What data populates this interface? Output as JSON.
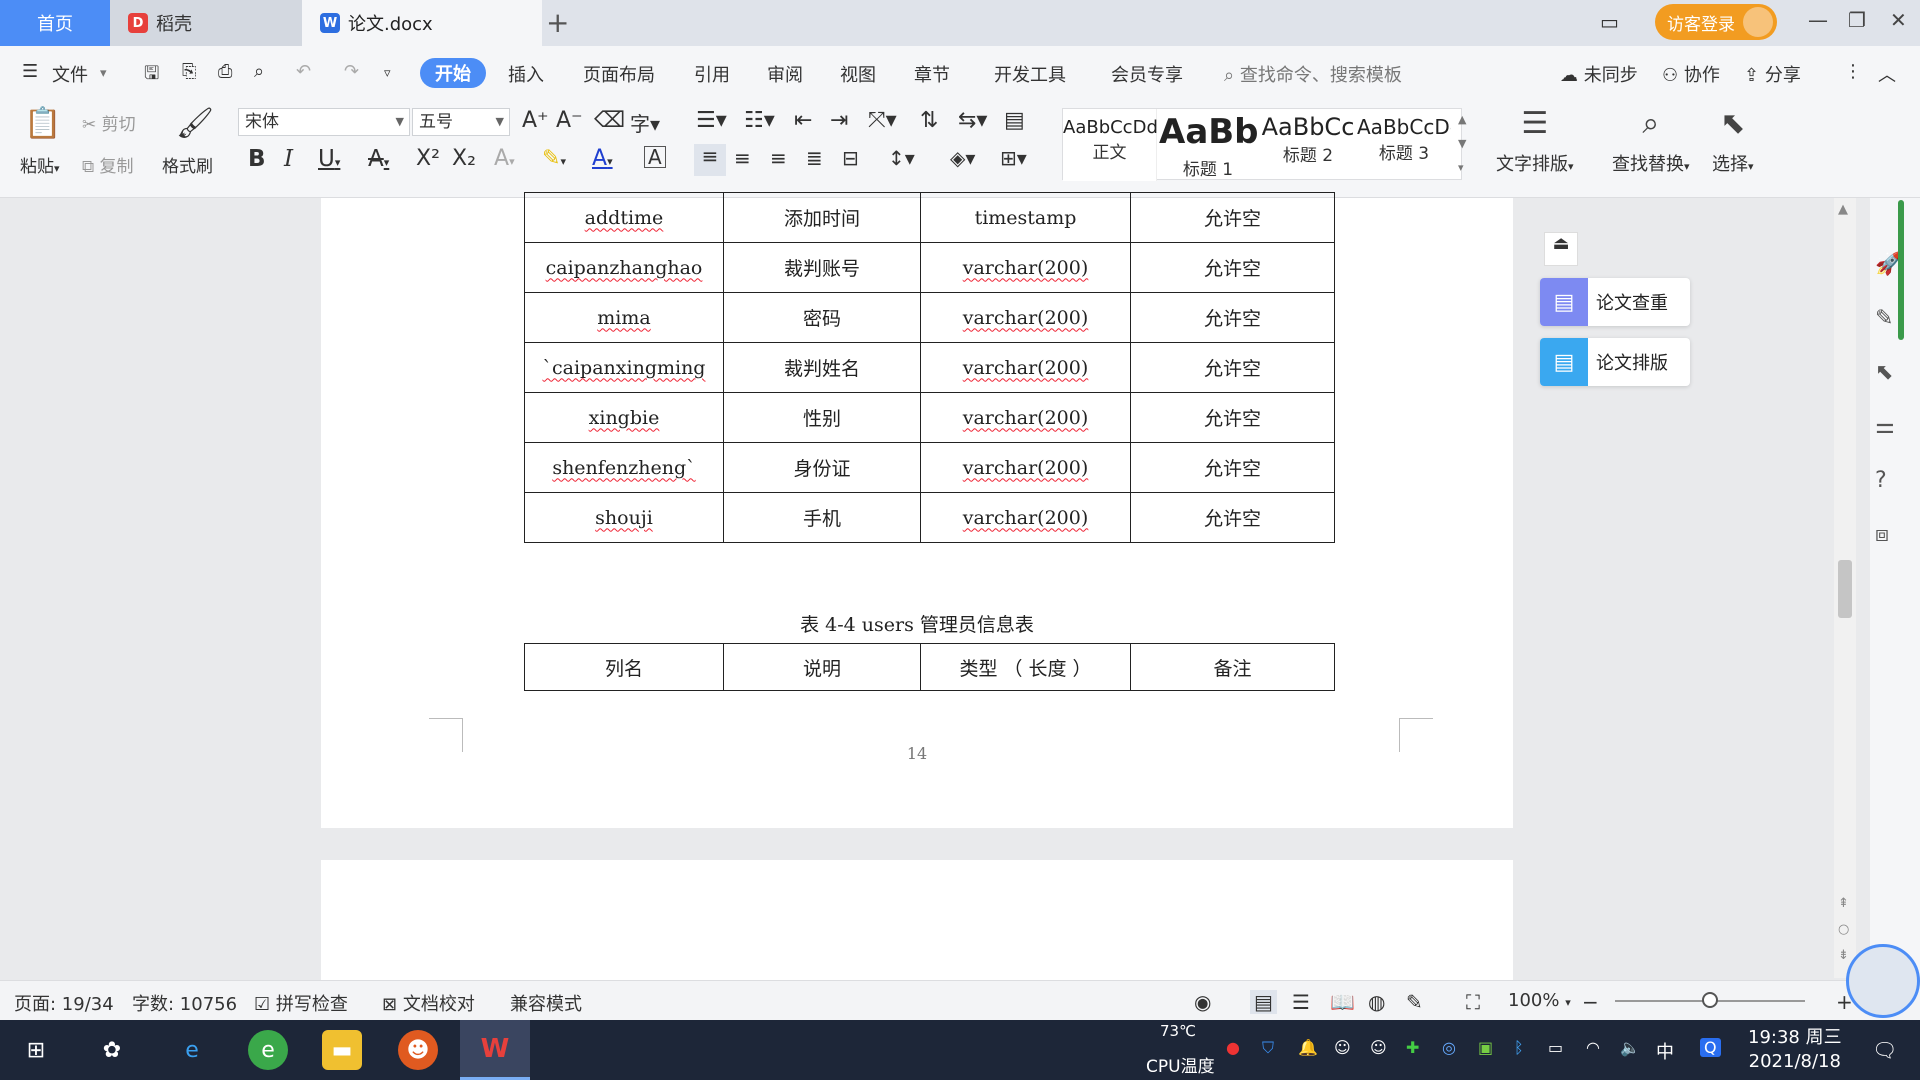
{
  "titlebar": {
    "tabs": [
      {
        "label": "首页"
      },
      {
        "label": "稻壳"
      },
      {
        "label": "论文.docx"
      }
    ],
    "login_label": "访客登录"
  },
  "menubar": {
    "file_label": "文件",
    "items": [
      "开始",
      "插入",
      "页面布局",
      "引用",
      "审阅",
      "视图",
      "章节",
      "开发工具",
      "会员专享"
    ],
    "search_placeholder": "查找命令、搜索模板",
    "right": [
      "未同步",
      "协作",
      "分享"
    ]
  },
  "ribbon": {
    "paste": "粘贴",
    "cut": "剪切",
    "copy": "复制",
    "format_painter": "格式刷",
    "font_name": "宋体",
    "font_size": "五号",
    "styles": [
      {
        "sample": "AaBbCcDd",
        "name": "正文"
      },
      {
        "sample": "AaBb",
        "name": "标题 1"
      },
      {
        "sample": "AaBbCc",
        "name": "标题 2"
      },
      {
        "sample": "AaBbCcDd",
        "name": "标题 3"
      }
    ],
    "text_layout": "文字排版",
    "find_replace": "查找替换",
    "select": "选择"
  },
  "document": {
    "table_rows": [
      [
        "addtime",
        "添加时间",
        "timestamp",
        "允许空"
      ],
      [
        "caipanzhanghao",
        "裁判账号",
        "varchar(200)",
        "允许空"
      ],
      [
        "mima",
        "密码",
        "varchar(200)",
        "允许空"
      ],
      [
        "`caipanxingming",
        "裁判姓名",
        "varchar(200)",
        "允许空"
      ],
      [
        "xingbie",
        "性别",
        "varchar(200)",
        "允许空"
      ],
      [
        "shenfenzheng`",
        "身份证",
        "varchar(200)",
        "允许空"
      ],
      [
        "shouji",
        "手机",
        "varchar(200)",
        "允许空"
      ]
    ],
    "caption": "表 4-4    users 管理员信息表",
    "header_row": [
      "列名",
      "说明",
      "类型 （ 长度 ）",
      "备注"
    ],
    "page_number": "14"
  },
  "sidepanel": {
    "buttons": [
      "论文查重",
      "论文排版"
    ]
  },
  "statusbar": {
    "page": "页面: 19/34",
    "words": "字数: 10756",
    "spell_check": "拼写检查",
    "doc_proof": "文档校对",
    "compat_mode": "兼容模式",
    "zoom": "100%",
    "zoom_level": 0.5
  },
  "taskbar": {
    "temp": "73℃",
    "cpu_label": "CPU温度",
    "ime": "中",
    "time": "19:38 周三",
    "date": "2021/8/18"
  },
  "colors": {
    "accent": "#4c8df6",
    "login": "#f29c21",
    "spell_squiggle": "#e22233",
    "taskbar": "#1d2638"
  }
}
